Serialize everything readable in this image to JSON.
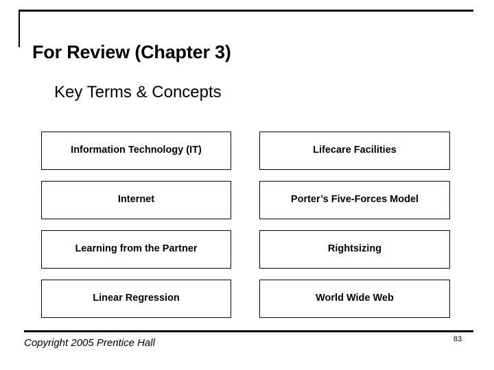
{
  "slide": {
    "title": "For Review (Chapter 3)",
    "subtitle": "Key Terms & Concepts"
  },
  "terms": {
    "rows": [
      {
        "left": "Information Technology (IT)",
        "right": "Lifecare Facilities"
      },
      {
        "left": "Internet",
        "right": "Porter’s Five-Forces Model"
      },
      {
        "left": "Learning from the Partner",
        "right": "Rightsizing"
      },
      {
        "left": "Linear Regression",
        "right": "World Wide Web"
      }
    ]
  },
  "footer": {
    "copyright": "Copyright 2005 Prentice Hall",
    "page_number": "83"
  },
  "colors": {
    "text": "#000000",
    "background": "#ffffff",
    "rule": "#000000",
    "cell_border": "#000000"
  }
}
